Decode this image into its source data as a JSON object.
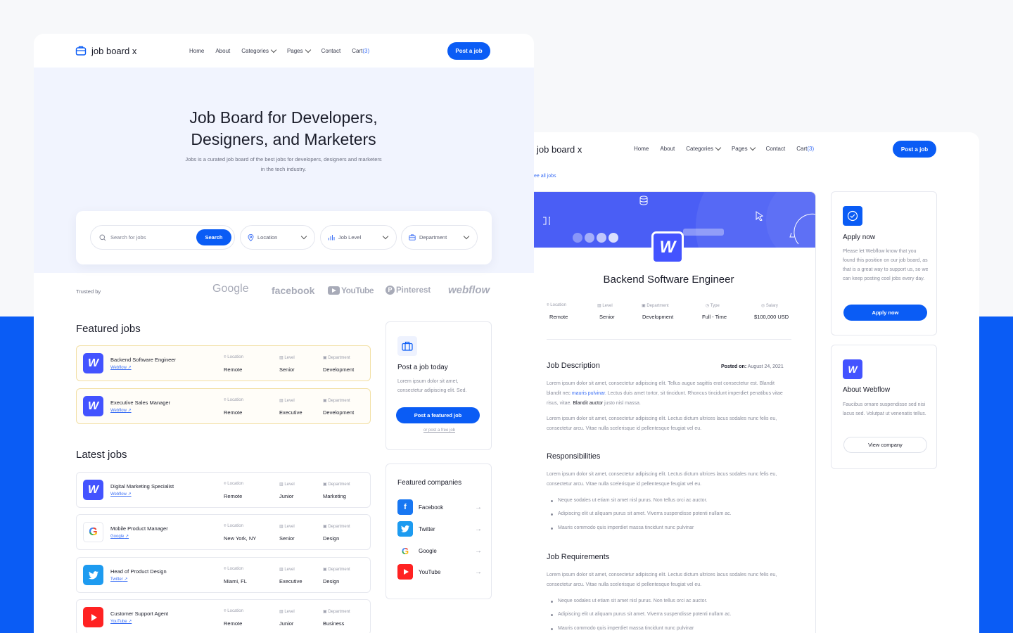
{
  "colors": {
    "primary": "#0a5cf5",
    "webflow": "#4353ff",
    "background": "#f7f8fa"
  },
  "left": {
    "brand": "job board x",
    "nav": {
      "home": "Home",
      "about": "About",
      "categories": "Categories",
      "pages": "Pages",
      "contact": "Contact",
      "cart": "Cart",
      "cart_count": "(3)",
      "post_button": "Post a job"
    },
    "hero": {
      "title": "Job Board for Developers, Designers, and Marketers",
      "subtitle": "Jobs is a curated job board of the best jobs for developers, designers and marketers in the tech industry."
    },
    "search": {
      "placeholder": "Search for jobs",
      "button": "Search",
      "location": "Location",
      "job_level": "Job Level",
      "department": "Department"
    },
    "trusted": {
      "label": "Trusted by",
      "brands": [
        "Google",
        "facebook",
        "YouTube",
        "Pinterest",
        "webflow"
      ]
    },
    "featured_title": "Featured jobs",
    "latest_title": "Latest jobs",
    "meta_labels": {
      "location": "Location",
      "level": "Level",
      "department": "Department"
    },
    "featured_jobs": [
      {
        "title": "Backend Software Engineer",
        "company": "Webflow",
        "location": "Remote",
        "level": "Senior",
        "department": "Development"
      },
      {
        "title": "Executive Sales Manager",
        "company": "Webflow",
        "location": "Remote",
        "level": "Executive",
        "department": "Development"
      }
    ],
    "latest_jobs": [
      {
        "title": "Digital Marketing Specialist",
        "company": "Webflow",
        "location": "Remote",
        "level": "Junior",
        "department": "Marketing"
      },
      {
        "title": "Mobile Product Manager",
        "company": "Google",
        "location": "New York, NY",
        "level": "Senior",
        "department": "Design"
      },
      {
        "title": "Head of Product Design",
        "company": "Twitter",
        "location": "Miami, FL",
        "level": "Executive",
        "department": "Design"
      },
      {
        "title": "Customer Support Agent",
        "company": "YouTube",
        "location": "Remote",
        "level": "Junior",
        "department": "Business"
      }
    ],
    "post_card": {
      "title": "Post a job today",
      "text": "Lorem ipsum dolor sit amet, consectetur adipiscing elit. Sed.",
      "button": "Post a featured job",
      "link": "or post a free job"
    },
    "featured_companies": {
      "title": "Featured companies",
      "items": [
        "Facebook",
        "Twitter",
        "Google",
        "YouTube"
      ]
    }
  },
  "right": {
    "brand": "job board x",
    "nav": {
      "home": "Home",
      "about": "About",
      "categories": "Categories",
      "pages": "Pages",
      "contact": "Contact",
      "cart": "Cart",
      "cart_count": "(3)",
      "post_button": "Post a job"
    },
    "see_all": "ee all jobs",
    "job": {
      "title": "Backend Software Engineer",
      "meta": [
        {
          "label": "Location",
          "value": "Remote"
        },
        {
          "label": "Level",
          "value": "Senior"
        },
        {
          "label": "Department",
          "value": "Development"
        },
        {
          "label": "Type",
          "value": "Full - Time"
        },
        {
          "label": "Salary",
          "value": "$100,000 USD"
        }
      ],
      "description_title": "Job Description",
      "posted_label": "Posted on:",
      "posted_date": "August 24, 2021",
      "desc_p1_a": "Lorem ipsum dolor sit amet, consectetur adipiscing elit. Tellus augue sagittis erat consectetur est. Blandit blandit nec ",
      "desc_p1_link": "mauris pulvinar",
      "desc_p1_b": ". Lectus duis amet tortor, sit tincidunt. Rhoncus tincidunt imperdiet penatibus vitae risus, vitae. ",
      "desc_p1_bold": "Blandit auctor",
      "desc_p1_c": " justo nisl massa.",
      "desc_p2": "Lorem ipsum dolor sit amet, consectetur adipiscing elit. Lectus dictum ultrices lacus sodales nunc felis eu, consectetur arcu. Vitae nulla scelerisque id pellentesque feugiat vel eu.",
      "resp_title": "Responsibilities",
      "resp_p": "Lorem ipsum dolor sit amet, consectetur adipiscing elit. Lectus dictum ultrices lacus sodales nunc felis eu, consectetur arcu. Vitae nulla scelerisque id pellentesque feugiat vel eu.",
      "resp_bullets": [
        "Neque sodales ut etiam sit amet nisl purus. Non tellus orci ac auctor.",
        "Adipiscing elit ut aliquam purus sit amet. Viverra suspendisse potenti nullam ac.",
        "Mauris commodo quis imperdiet massa tincidunt nunc pulvinar"
      ],
      "req_title": "Job Requirements",
      "req_p": "Lorem ipsum dolor sit amet, consectetur adipiscing elit. Lectus dictum ultrices lacus sodales nunc felis eu, consectetur arcu. Vitae nulla scelerisque id pellentesque feugiat vel eu.",
      "req_bullets": [
        "Neque sodales ut etiam sit amet nisl purus. Non tellus orci ac auctor.",
        "Adipiscing elit ut aliquam purus sit amet. Viverra suspendisse potenti nullam ac.",
        "Mauris commodo quis imperdiet massa tincidunt nunc pulvinar"
      ]
    },
    "apply_card": {
      "title": "Apply now",
      "text": "Please let Webflow know that you found this position on our job board, as that is a great way to support us, so we can keep posting cool jobs every day.",
      "button": "Apply now"
    },
    "about_card": {
      "title": "About Webflow",
      "text": "Faucibus ornare suspendisse sed nisi lacus sed. Volutpat ut venenatis tellus.",
      "button": "View company"
    }
  }
}
